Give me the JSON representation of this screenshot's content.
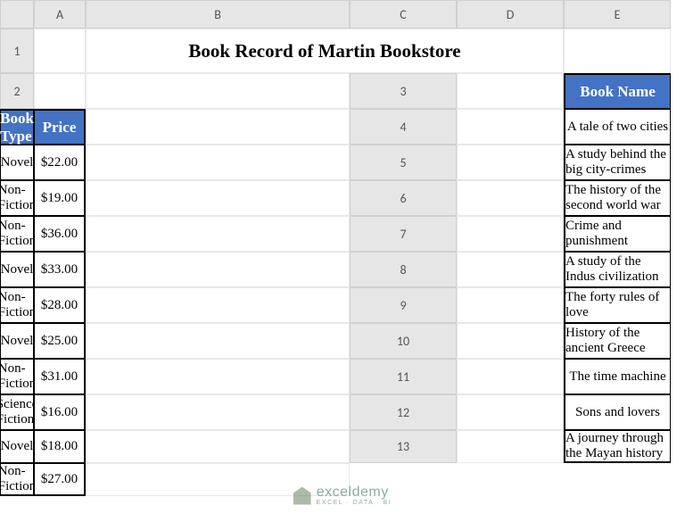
{
  "columns": [
    "A",
    "B",
    "C",
    "D",
    "E"
  ],
  "rows": [
    "1",
    "2",
    "3",
    "4",
    "5",
    "6",
    "7",
    "8",
    "9",
    "10",
    "11",
    "12",
    "13"
  ],
  "title": "Book Record of Martin Bookstore",
  "headers": {
    "name": "Book Name",
    "type": "Book Type",
    "price": "Price"
  },
  "books": [
    {
      "name": "A tale of two cities",
      "type": "Novel",
      "price": "$22.00"
    },
    {
      "name": "A study behind the big city-crimes",
      "type": "Non-Fiction",
      "price": "$19.00"
    },
    {
      "name": "The history of the second world war",
      "type": "Non-Fiction",
      "price": "$36.00"
    },
    {
      "name": "Crime and punishment",
      "type": "Novel",
      "price": "$33.00"
    },
    {
      "name": "A study of the Indus civilization",
      "type": "Non-Fiction",
      "price": "$28.00"
    },
    {
      "name": "The forty rules of love",
      "type": "Novel",
      "price": "$25.00"
    },
    {
      "name": "History of the ancient Greece",
      "type": "Non-Fiction",
      "price": "$31.00"
    },
    {
      "name": "The time machine",
      "type": "Science Fiction",
      "price": "$16.00"
    },
    {
      "name": "Sons and lovers",
      "type": "Novel",
      "price": "$18.00"
    },
    {
      "name": "A journey through the Mayan history",
      "type": "Non-Fiction",
      "price": "$27.00"
    }
  ],
  "watermark": {
    "main": "exceldemy",
    "sub": "EXCEL · DATA · BI"
  }
}
